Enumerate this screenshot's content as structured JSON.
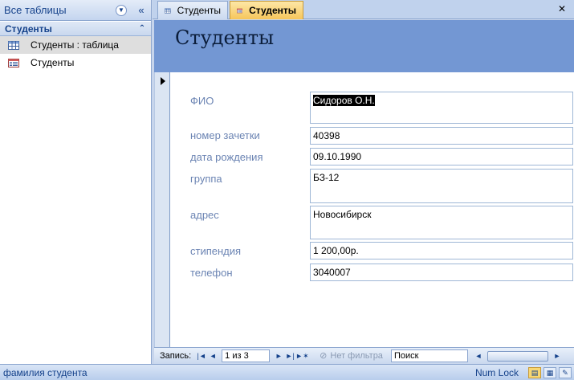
{
  "nav_pane": {
    "header_title": "Все таблицы",
    "group_title": "Студенты",
    "items": [
      {
        "label": "Студенты : таблица",
        "icon": "table-icon",
        "selected": true
      },
      {
        "label": "Студенты",
        "icon": "form-icon",
        "selected": false
      }
    ]
  },
  "tabs": [
    {
      "label": "Студенты",
      "icon": "table-icon",
      "active": false
    },
    {
      "label": "Студенты",
      "icon": "form-icon",
      "active": true
    }
  ],
  "form": {
    "title": "Студенты",
    "fields": [
      {
        "label": "ФИО",
        "value": "Сидоров О.Н."
      },
      {
        "label": "номер зачетки",
        "value": "40398"
      },
      {
        "label": "дата рождения",
        "value": "09.10.1990"
      },
      {
        "label": "группа",
        "value": "БЗ-12"
      },
      {
        "label": "адрес",
        "value": "Новосибирск"
      },
      {
        "label": "стипендия",
        "value": "1 200,00р."
      },
      {
        "label": "телефон",
        "value": "3040007"
      }
    ]
  },
  "record_nav": {
    "label": "Запись:",
    "current": "1 из 3",
    "filter_label": "Нет фильтра",
    "search_label": "Поиск"
  },
  "status_bar": {
    "text": "фамилия студента",
    "numlock": "Num Lock"
  },
  "colors": {
    "form_header": "#7397d3",
    "active_tab": "#f6c65b",
    "label_text": "#6b84b3"
  }
}
